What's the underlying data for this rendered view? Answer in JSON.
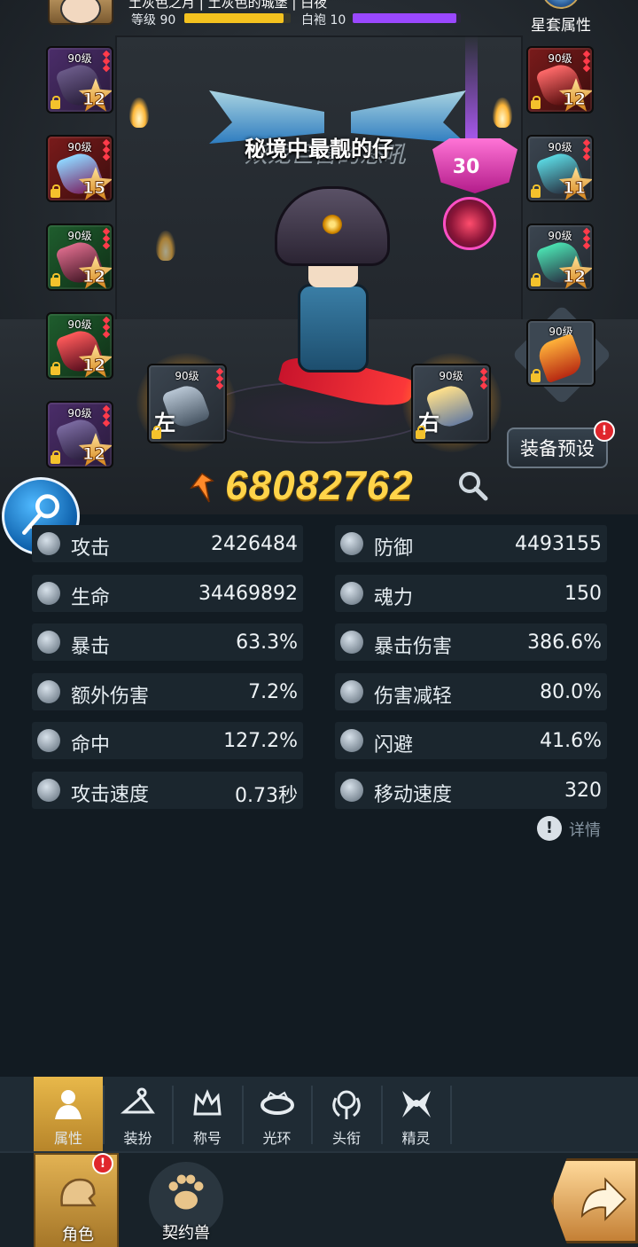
{
  "header": {
    "player_name": "土灰色之月",
    "guild_name": "土灰色的城堡",
    "extra_tag": "白夜",
    "level_label": "等级 90",
    "level_progress": 0.93,
    "rank_label": "白袍 10",
    "rank_progress": 0.96,
    "star_set_label": "星套属性"
  },
  "colors": {
    "power": "#ffd44a",
    "level_bar": "#f4c21f",
    "rank_bar": "#9a48ff",
    "alert": "#e0262c",
    "active_tab": "#e8b84a"
  },
  "hero": {
    "title_script": "双龙巨兽的怒吼",
    "title_text": "秘境中最靓的仔",
    "rank_badge": "30"
  },
  "left_slots": [
    {
      "level": "90级",
      "stars": "12",
      "icon": "helmet-icon"
    },
    {
      "level": "90级",
      "stars": "15",
      "icon": "shoulder-armor-icon"
    },
    {
      "level": "90级",
      "stars": "12",
      "icon": "gloves-icon"
    },
    {
      "level": "90级",
      "stars": "12",
      "icon": "boots-icon"
    },
    {
      "level": "90级",
      "stars": "12",
      "icon": "cape-icon"
    }
  ],
  "right_slots": [
    {
      "level": "90级",
      "stars": "12",
      "icon": "necklace-icon"
    },
    {
      "level": "90级",
      "stars": "11",
      "icon": "amulet-icon"
    },
    {
      "level": "90级",
      "stars": "12",
      "icon": "ring-icon"
    }
  ],
  "special_slot": {
    "level": "90级",
    "icon": "flame-crest-icon"
  },
  "hands": {
    "left": {
      "level": "90级",
      "side": "左",
      "icon": "left-hand-weapon-icon"
    },
    "right": {
      "level": "90级",
      "side": "右",
      "icon": "right-hand-weapon-icon"
    }
  },
  "power": {
    "value": "68082762"
  },
  "preset_button": "装备预设",
  "alert_mark": "!",
  "stats": [
    {
      "name": "攻击",
      "value": "2426484",
      "icon": "attack-icon"
    },
    {
      "name": "防御",
      "value": "4493155",
      "icon": "defense-icon"
    },
    {
      "name": "生命",
      "value": "34469892",
      "icon": "heart-icon"
    },
    {
      "name": "魂力",
      "value": "150",
      "icon": "soul-power-icon"
    },
    {
      "name": "暴击",
      "value": "63.3%",
      "icon": "crit-icon"
    },
    {
      "name": "暴击伤害",
      "value": "386.6%",
      "icon": "crit-damage-icon"
    },
    {
      "name": "额外伤害",
      "value": "7.2%",
      "icon": "extra-damage-icon"
    },
    {
      "name": "伤害减轻",
      "value": "80.0%",
      "icon": "damage-reduction-icon"
    },
    {
      "name": "命中",
      "value": "127.2%",
      "icon": "accuracy-icon"
    },
    {
      "name": "闪避",
      "value": "41.6%",
      "icon": "dodge-icon"
    },
    {
      "name": "攻击速度",
      "value": "0.73秒",
      "icon": "attack-speed-icon"
    },
    {
      "name": "移动速度",
      "value": "320",
      "icon": "move-speed-icon"
    }
  ],
  "details_label": "详情",
  "tabs": [
    {
      "label": "属性",
      "icon": "person-icon",
      "active": true
    },
    {
      "label": "装扮",
      "icon": "hanger-icon",
      "active": false
    },
    {
      "label": "称号",
      "icon": "crown-icon",
      "active": false
    },
    {
      "label": "光环",
      "icon": "halo-icon",
      "active": false
    },
    {
      "label": "头衔",
      "icon": "skull-crest-icon",
      "active": false
    },
    {
      "label": "精灵",
      "icon": "sprite-wings-icon",
      "active": false
    }
  ],
  "bottom_nav": [
    {
      "label": "角色",
      "icon": "character-icon",
      "active": true
    },
    {
      "label": "契约兽",
      "icon": "paw-icon",
      "active": false
    }
  ]
}
